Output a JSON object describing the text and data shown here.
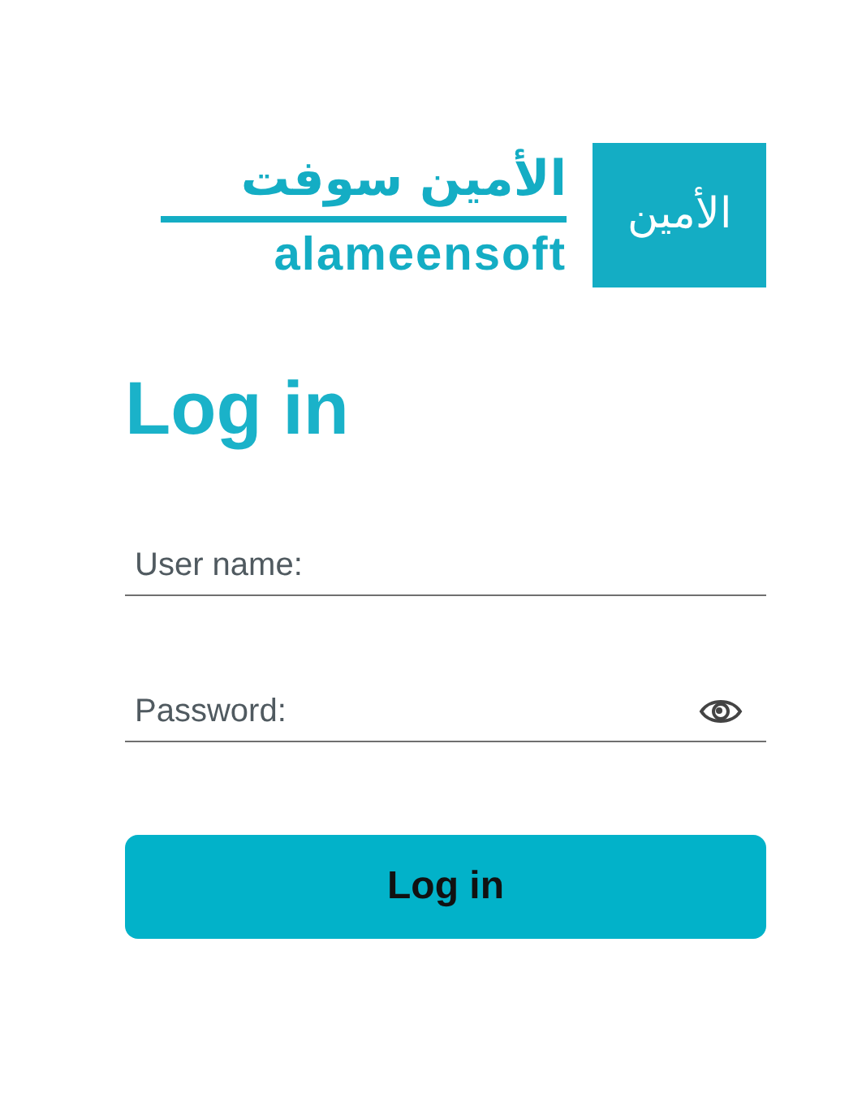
{
  "logo": {
    "arabic_name": "الأمين سوفت",
    "latin_name": "alameensoft",
    "badge_text": "الأمين"
  },
  "title": "Log in",
  "fields": [
    {
      "kind": "text",
      "placeholder": "User name:"
    },
    {
      "kind": "password",
      "placeholder": "Password:"
    }
  ],
  "button": "Log in"
}
